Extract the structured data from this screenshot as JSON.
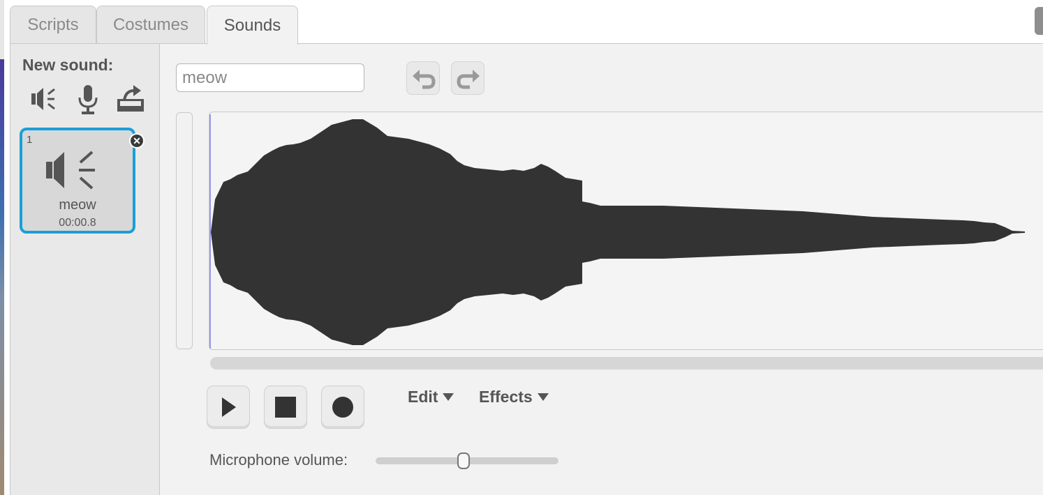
{
  "tabs": [
    {
      "label": "Scripts",
      "active": false
    },
    {
      "label": "Costumes",
      "active": false
    },
    {
      "label": "Sounds",
      "active": true
    }
  ],
  "left_panel": {
    "new_sound_label": "New sound:",
    "new_sound_actions": [
      "sound-library-icon",
      "microphone-icon",
      "upload-icon"
    ]
  },
  "sounds": [
    {
      "number": "1",
      "name": "meow",
      "duration": "00:00.8",
      "selected": true
    }
  ],
  "editor": {
    "sound_name_value": "meow",
    "undo_icon": "undo-icon",
    "redo_icon": "redo-icon",
    "controls": [
      "play-icon",
      "stop-icon",
      "record-icon"
    ],
    "edit_menu": "Edit",
    "effects_menu": "Effects",
    "mic_volume_label": "Microphone volume:",
    "mic_volume_level": 0.48
  },
  "colors": {
    "selected_border": "#1a9fd8",
    "waveform": "#333333",
    "panel_bg": "#f2f2f2"
  }
}
